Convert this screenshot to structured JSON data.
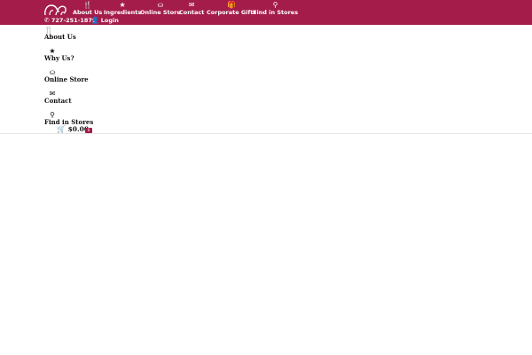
{
  "brand": {
    "logo_icon": "elephant-logo-icon"
  },
  "nav": {
    "items": [
      {
        "label": "About Us",
        "icon": "utensils-icon"
      },
      {
        "label": "Ingredients",
        "icon": "star-icon"
      },
      {
        "label": "Online Store",
        "icon": "basket-icon"
      },
      {
        "label": "Contact",
        "icon": "envelope-icon"
      },
      {
        "label": "Corporate Gifts",
        "icon": "gift-icon"
      },
      {
        "label": "Find in Stores",
        "icon": "map-pin-icon"
      }
    ]
  },
  "contact": {
    "phone": "727-251-1879",
    "login_label": "Login"
  },
  "side_menu": {
    "items": [
      {
        "label": "About Us",
        "icon": "utensils-icon"
      },
      {
        "label": "Why Us?",
        "icon": "star-icon"
      },
      {
        "label": "Online Store",
        "icon": "basket-icon"
      },
      {
        "label": "Contact",
        "icon": "envelope-icon"
      },
      {
        "label": "Find in Stores",
        "icon": "map-pin-icon"
      }
    ]
  },
  "cart": {
    "total": "$0.00",
    "count": "0"
  },
  "colors": {
    "brand": "#a41c4a",
    "text": "#111111",
    "background": "#ffffff"
  }
}
